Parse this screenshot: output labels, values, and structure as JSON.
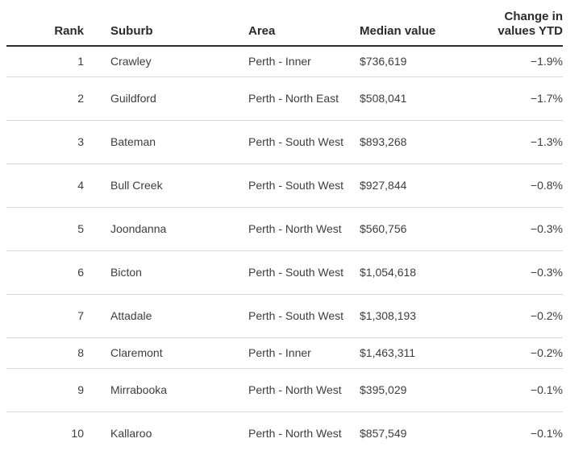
{
  "table": {
    "headers": {
      "rank": "Rank",
      "suburb": "Suburb",
      "area": "Area",
      "median": "Median value",
      "change_line1": "Change in",
      "change_line2": "values YTD"
    },
    "rows": [
      {
        "rank": "1",
        "suburb": "Crawley",
        "area": "Perth - Inner",
        "median": "$736,619",
        "change": "−1.9%"
      },
      {
        "rank": "2",
        "suburb": "Guildford",
        "area": "Perth - North East",
        "median": "$508,041",
        "change": "−1.7%"
      },
      {
        "rank": "3",
        "suburb": "Bateman",
        "area": "Perth - South West",
        "median": "$893,268",
        "change": "−1.3%"
      },
      {
        "rank": "4",
        "suburb": "Bull Creek",
        "area": "Perth - South West",
        "median": "$927,844",
        "change": "−0.8%"
      },
      {
        "rank": "5",
        "suburb": "Joondanna",
        "area": "Perth - North West",
        "median": "$560,756",
        "change": "−0.3%"
      },
      {
        "rank": "6",
        "suburb": "Bicton",
        "area": "Perth - South West",
        "median": "$1,054,618",
        "change": "−0.3%"
      },
      {
        "rank": "7",
        "suburb": "Attadale",
        "area": "Perth - South West",
        "median": "$1,308,193",
        "change": "−0.2%"
      },
      {
        "rank": "8",
        "suburb": "Claremont",
        "area": "Perth - Inner",
        "median": "$1,463,311",
        "change": "−0.2%"
      },
      {
        "rank": "9",
        "suburb": "Mirrabooka",
        "area": "Perth - North West",
        "median": "$395,029",
        "change": "−0.1%"
      },
      {
        "rank": "10",
        "suburb": "Kallaroo",
        "area": "Perth - North West",
        "median": "$857,549",
        "change": "−0.1%"
      }
    ]
  }
}
